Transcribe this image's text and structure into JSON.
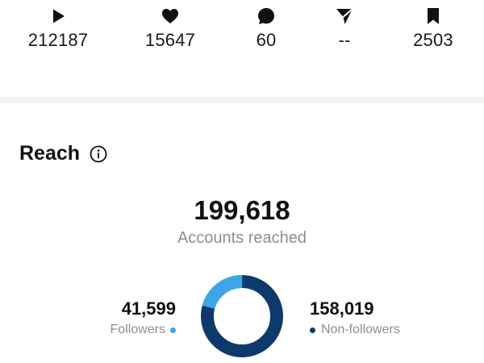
{
  "metrics": [
    {
      "icon": "play-icon",
      "value": "212187"
    },
    {
      "icon": "heart-icon",
      "value": "15647"
    },
    {
      "icon": "comment-icon",
      "value": "60"
    },
    {
      "icon": "share-icon",
      "value": "--"
    },
    {
      "icon": "bookmark-icon",
      "value": "2503"
    }
  ],
  "reach": {
    "title": "Reach",
    "info_icon": "info-icon",
    "total": "199,618",
    "total_label": "Accounts reached",
    "followers": {
      "value": "41,599",
      "label": "Followers",
      "color": "#3ea6e8"
    },
    "non_followers": {
      "value": "158,019",
      "label": "Non-followers",
      "color": "#0d3a6b"
    },
    "followers_fraction": 0.208
  }
}
